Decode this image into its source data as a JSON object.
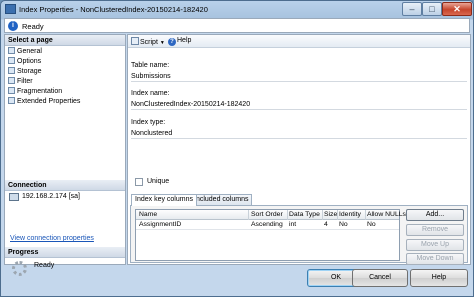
{
  "window": {
    "title": "Index Properties - NonClusteredIndex-20150214-182420",
    "minimize": "–",
    "maximize": "□",
    "close": "✕"
  },
  "status": {
    "icon": "i",
    "text": "Ready"
  },
  "sidebar": {
    "select_page_header": "Select a page",
    "pages": [
      "General",
      "Options",
      "Storage",
      "Filter",
      "Fragmentation",
      "Extended Properties"
    ],
    "connection_header": "Connection",
    "connection_text": "192.168.2.174 [sa]",
    "connection_link": "View connection properties",
    "progress_header": "Progress",
    "progress_text": "Ready"
  },
  "toolbar": {
    "script_label": "Script",
    "script_dropdown": "▼",
    "help_label": "Help",
    "help_icon": "?"
  },
  "form": {
    "table_name_label": "Table name:",
    "table_name_value": "Submissions",
    "index_name_label": "Index name:",
    "index_name_value": "NonClusteredIndex-20150214-182420",
    "index_type_label": "Index type:",
    "index_type_value": "Nonclustered",
    "unique_label": "Unique",
    "unique_checked": false
  },
  "tabs": [
    {
      "label": "Index key columns",
      "active": true
    },
    {
      "label": "Included columns",
      "active": false
    }
  ],
  "grid": {
    "columns": [
      "Name",
      "Sort Order",
      "Data Type",
      "Size",
      "Identity",
      "Allow NULLs"
    ],
    "rows": [
      [
        "AssignmentID",
        "Ascending",
        "int",
        "4",
        "No",
        "No"
      ]
    ]
  },
  "side_buttons": {
    "add": "Add...",
    "remove": "Remove",
    "move_up": "Move Up",
    "move_down": "Move Down"
  },
  "dialog_buttons": {
    "ok": "OK",
    "cancel": "Cancel",
    "help": "Help"
  }
}
